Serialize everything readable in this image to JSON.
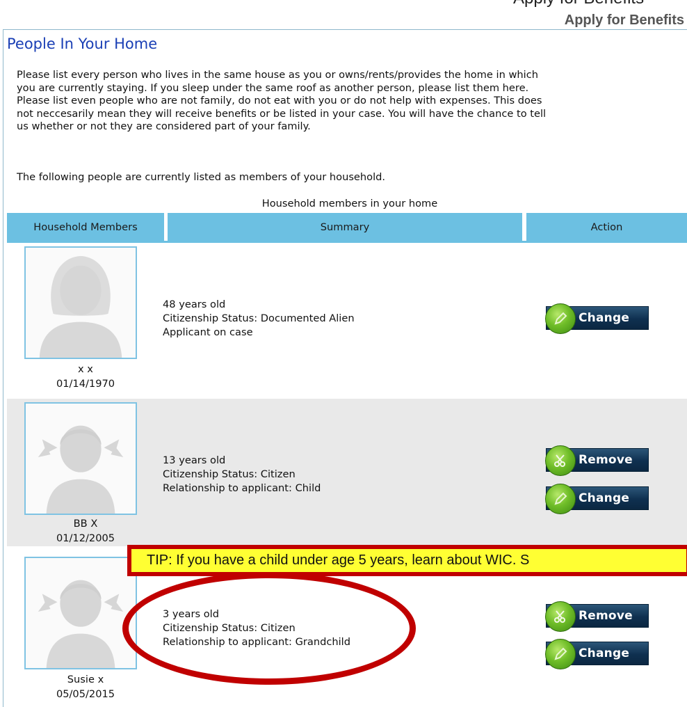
{
  "header": {
    "top_fragment": "Apply for Benefits",
    "apply_title": "Apply for Benefits"
  },
  "panel": {
    "title": "People In Your Home",
    "intro_lines": "Please list every person who lives in the same house as you or owns/rents/provides the home in which\nyou are currently staying. If you sleep under the same roof as another person, please list them here.\nPlease list even people who are not family, do not eat with you or do not help with expenses. This does\nnot neccesarily mean they will receive benefits or be listed in your case. You will have the chance to tell\nus whether or not they are considered part of your family.",
    "following": "The following people are currently listed as members of your household.",
    "caption": "Household members in your home"
  },
  "table": {
    "headers": {
      "members": "Household Members",
      "summary": "Summary",
      "action": "Action"
    },
    "rows": [
      {
        "name": "x x",
        "dob": "01/14/1970",
        "age": "48 years old",
        "citizenship": "Citizenship Status: Documented Alien",
        "extra": "Applicant on case",
        "avatar": "adult-female-silhouette-icon",
        "buttons": [
          "Change"
        ]
      },
      {
        "name": "BB X",
        "dob": "01/12/2005",
        "age": "13 years old",
        "citizenship": "Citizenship Status: Citizen",
        "extra": "Relationship to applicant: Child",
        "avatar": "child-girl-silhouette-icon",
        "buttons": [
          "Remove",
          "Change"
        ]
      },
      {
        "name": "Susie x",
        "dob": "05/05/2015",
        "age": "3 years old",
        "citizenship": "Citizenship Status: Citizen",
        "extra": "Relationship to applicant: Grandchild",
        "avatar": "child-girl-silhouette-icon",
        "buttons": [
          "Remove",
          "Change"
        ]
      }
    ]
  },
  "tip": {
    "text": "TIP: If you have a child under age 5 years, learn about WIC. S"
  },
  "colors": {
    "header_bg": "#6cc0e2",
    "title_blue": "#1a3fb5",
    "button_navy": "#0f3050",
    "icon_green": "#6fbd28",
    "tip_yellow": "#ffff33",
    "annotation_red": "#c00000",
    "row_shade": "#e9e9e9"
  }
}
